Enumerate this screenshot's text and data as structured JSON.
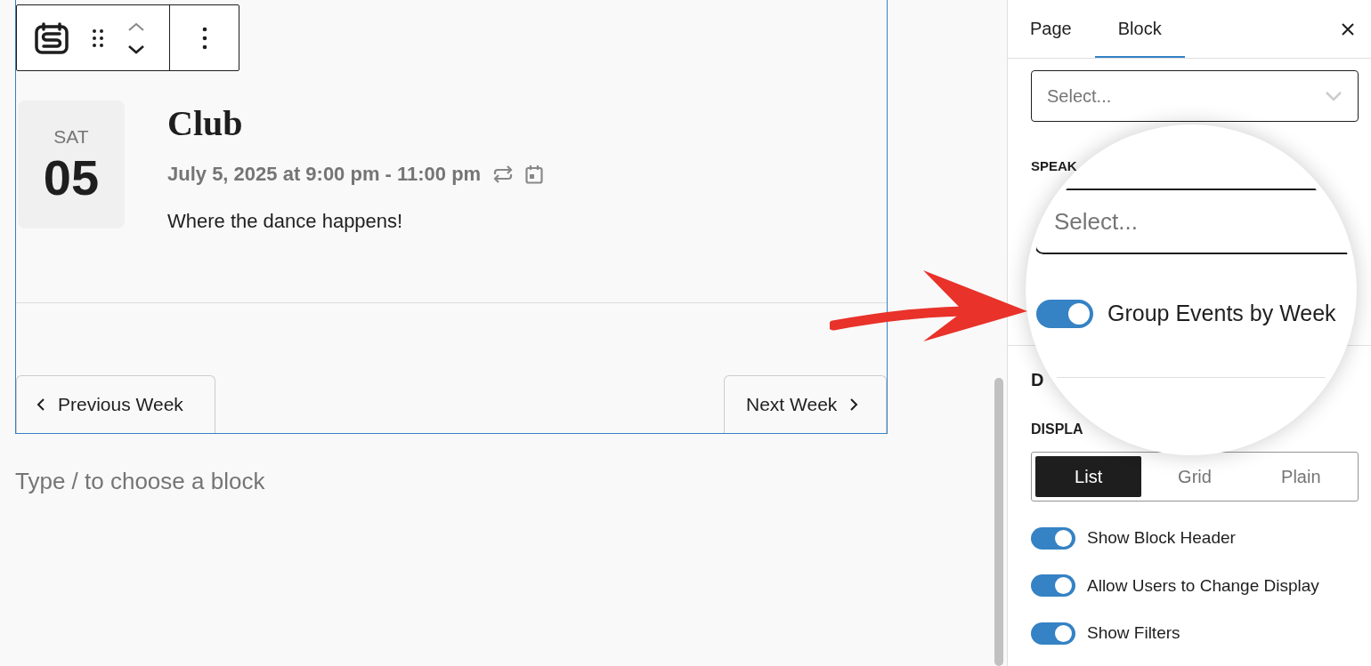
{
  "event": {
    "weekday": "SAT",
    "day": "05",
    "title": "Club",
    "datetime": "July 5, 2025 at 9:00 pm - 11:00 pm",
    "description": "Where the dance happens!"
  },
  "pagination": {
    "previous": "Previous Week",
    "next": "Next Week"
  },
  "block_placeholder": "Type / to choose a block",
  "sidebar": {
    "tabs": [
      {
        "label": "Page",
        "selected": false
      },
      {
        "label": "Block",
        "selected": true
      }
    ],
    "select_placeholder": "Select...",
    "speakers_label": "SPEAK",
    "section_label": "D",
    "display_label": "DISPLA",
    "display_options": [
      {
        "label": "List",
        "selected": true
      },
      {
        "label": "Grid",
        "selected": false
      },
      {
        "label": "Plain",
        "selected": false
      }
    ],
    "toggles": [
      {
        "label": "Show Block Header",
        "on": true
      },
      {
        "label": "Allow Users to Change Display",
        "on": true
      },
      {
        "label": "Show Filters",
        "on": true
      }
    ]
  },
  "magnifier": {
    "select_placeholder": "Select...",
    "toggle": {
      "label": "Group Events by Week",
      "on": true
    }
  }
}
